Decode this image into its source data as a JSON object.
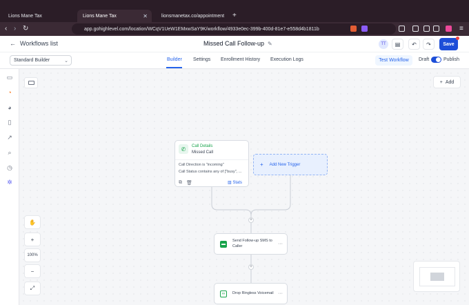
{
  "browser": {
    "tabs": [
      {
        "label": "Lions Mane Tax",
        "active": false
      },
      {
        "label": "Lions Mane Tax",
        "active": true
      },
      {
        "label": "lionsmanetax.co/appointment",
        "active": false
      }
    ],
    "new_tab_icon": "plus-icon",
    "url": "app.gohighlevel.com/location/WCqV1UeW1EMxwSaY9K/workflow/4933e0ec-399b-400d-81e7-e558d4b1811b"
  },
  "header": {
    "back_label": "Workflows list",
    "title": "Missed Call Follow-up",
    "avatar_initials": "TT",
    "save_label": "Save"
  },
  "subbar": {
    "builder_selector": "Standard Builder",
    "tabs": [
      {
        "label": "Builder",
        "active": true
      },
      {
        "label": "Settings",
        "active": false
      },
      {
        "label": "Enrollment History",
        "active": false
      },
      {
        "label": "Execution Logs",
        "active": false
      }
    ],
    "test_label": "Test Workflow",
    "draft_label": "Draft",
    "publish_label": "Publish",
    "published": true
  },
  "canvas": {
    "add_label": "Add",
    "zoom_level": "100%",
    "trigger": {
      "title": "Call Details",
      "subtitle": "Missed Call",
      "conditions": [
        "Call Direction is \"incoming\"",
        "Call Status contains any of [\"busy\", ..."
      ],
      "stats_label": "Stats"
    },
    "add_trigger_label": "Add New Trigger",
    "actions": [
      {
        "label": "Send Follow-up SMS to Caller",
        "icon": "message-icon"
      },
      {
        "label": "Drop Ringless Voicemail",
        "icon": "voicemail-icon"
      }
    ]
  },
  "colors": {
    "accent": "#2563eb",
    "save": "#1d4ed8",
    "trigger_green": "#16a34a",
    "browser_chrome": "#2b1d27"
  }
}
